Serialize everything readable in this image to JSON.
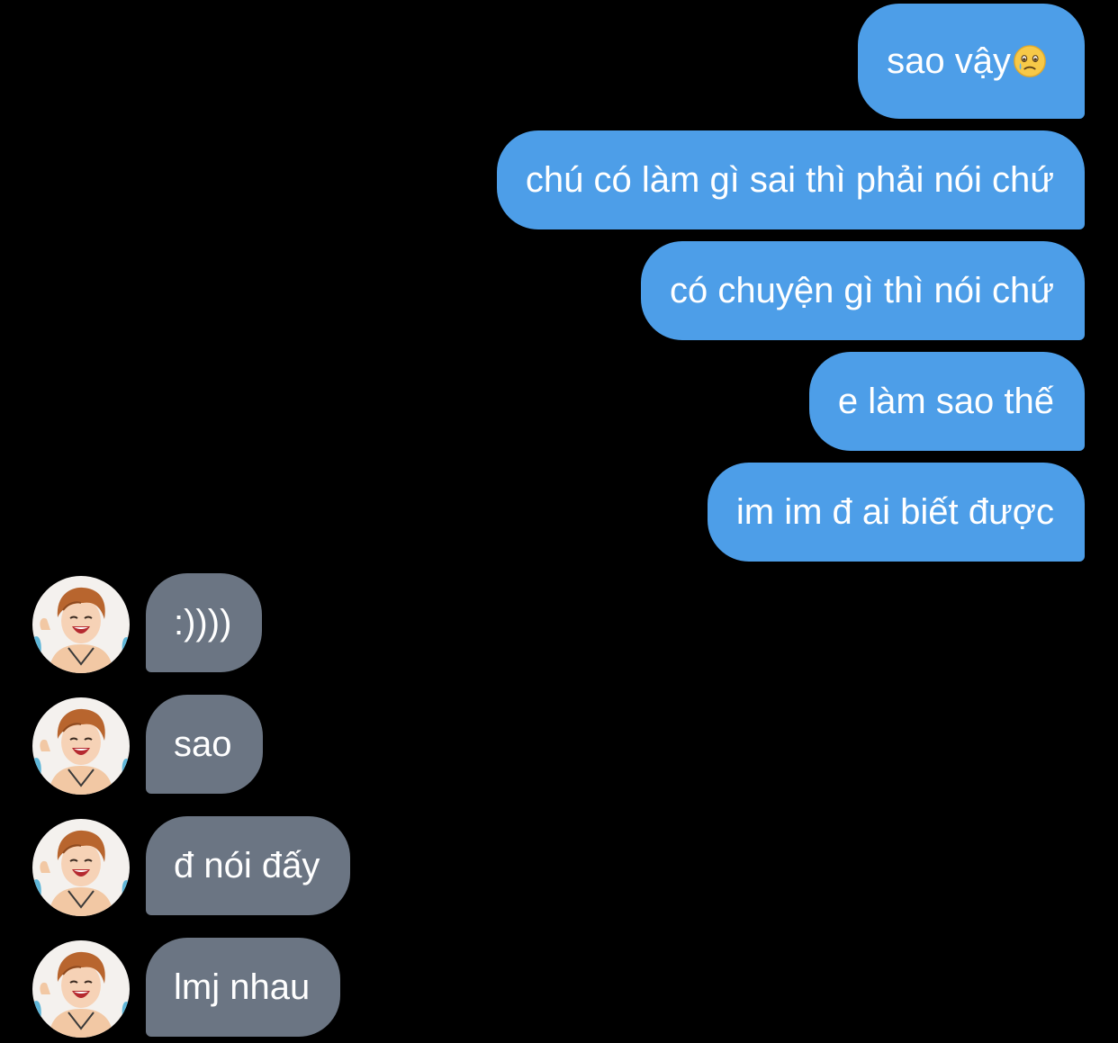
{
  "colors": {
    "background": "#000000",
    "outgoing_bubble": "#4d9ee8",
    "incoming_bubble": "#6b7583",
    "text": "#ffffff"
  },
  "messages_out": [
    {
      "text": "sao vậy",
      "emoji": "face-holding-back-tears-icon"
    },
    {
      "text": "chú có làm gì sai thì phải nói chứ"
    },
    {
      "text": "có chuyện gì thì nói chứ"
    },
    {
      "text": "e làm sao thế"
    },
    {
      "text": "im im đ ai biết được"
    }
  ],
  "messages_in": [
    {
      "text": ":))))"
    },
    {
      "text": "sao"
    },
    {
      "text": "đ nói đấy"
    },
    {
      "text": "lmj nhau"
    }
  ]
}
